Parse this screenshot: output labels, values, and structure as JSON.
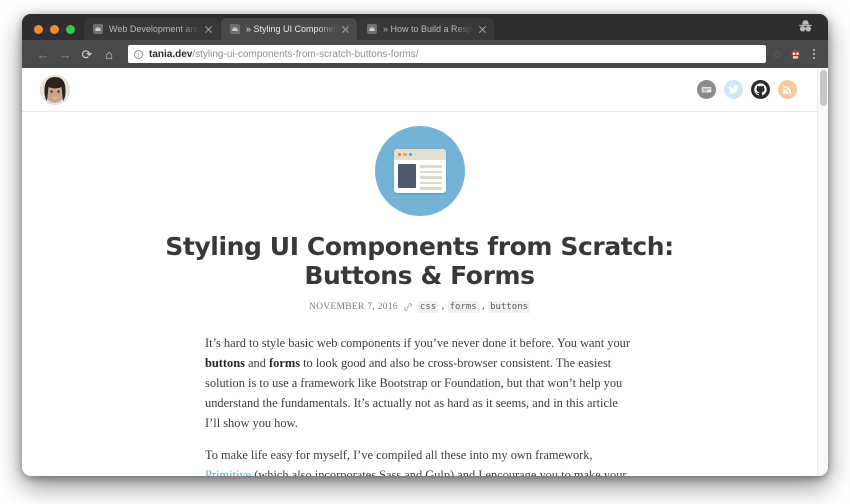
{
  "window": {
    "traffic_lights": [
      {
        "name": "close",
        "color": "#f08a35"
      },
      {
        "name": "minimize",
        "color": "#f08a35"
      },
      {
        "name": "maximize",
        "color": "#34c749"
      }
    ],
    "incognito_icon": "incognito-icon"
  },
  "tabs": [
    {
      "title": "Web Development and Design",
      "favicon": "site-favicon",
      "active": false,
      "close_icon": "close-icon"
    },
    {
      "title": "» Styling UI Components from",
      "favicon": "site-favicon",
      "active": true,
      "close_icon": "close-icon"
    },
    {
      "title": "» How to Build a Responsive In",
      "favicon": "site-favicon",
      "active": false,
      "close_icon": "close-icon"
    }
  ],
  "toolbar": {
    "back_icon": "back-arrow-icon",
    "forward_icon": "forward-arrow-icon",
    "reload_icon": "reload-icon",
    "home_icon": "home-icon",
    "info_icon": "info-icon",
    "info_glyph": "i",
    "url_domain": "tania.dev",
    "url_path": "/styling-ui-components-from-scratch-buttons-forms/",
    "star_icon": "bookmark-star-icon",
    "star_glyph": "☆",
    "extension_icon": "extension-icon",
    "menu_icon": "overflow-menu-icon"
  },
  "site_header": {
    "avatar": "author-avatar",
    "socials": [
      {
        "name": "email-icon",
        "color": "#8b8b8b"
      },
      {
        "name": "twitter-icon",
        "color": "#cfe6f5"
      },
      {
        "name": "github-icon",
        "color": "#ffffff"
      },
      {
        "name": "rss-icon",
        "color": "#f7c99a"
      }
    ]
  },
  "article": {
    "hero_icon": "browser-window-illustration",
    "hero_circle_color": "#72b3d6",
    "title": "Styling UI Components from Scratch: Buttons & Forms",
    "date": "NOVEMBER 7, 2016",
    "link_icon": "link-icon",
    "link_glyph": "🔗",
    "tags": [
      "css",
      "forms",
      "buttons"
    ],
    "tag_separator": ",",
    "paragraphs": [
      {
        "parts": [
          {
            "t": "text",
            "v": "It’s hard to style basic web components if you’ve never done it before. You want your "
          },
          {
            "t": "strong",
            "v": "buttons"
          },
          {
            "t": "text",
            "v": " and "
          },
          {
            "t": "strong",
            "v": "forms"
          },
          {
            "t": "text",
            "v": " to look good and also be cross-browser consistent. The easiest solution is to use a framework like Bootstrap or Foundation, but that won’t help you understand the fundamentals. It’s actually not as hard as it seems, and in this article I’ll show you how."
          }
        ]
      },
      {
        "parts": [
          {
            "t": "text",
            "v": "To make life easy for myself, I’ve compiled all these into my own framework, "
          },
          {
            "t": "link",
            "v": "Primitive"
          },
          {
            "t": "text",
            "v": " (which also incorporates Sass and Gulp) and I encourage you to make your own as well, even if only for learning purposes."
          }
        ]
      }
    ]
  },
  "scrollbar": {
    "name": "page-scrollbar"
  }
}
